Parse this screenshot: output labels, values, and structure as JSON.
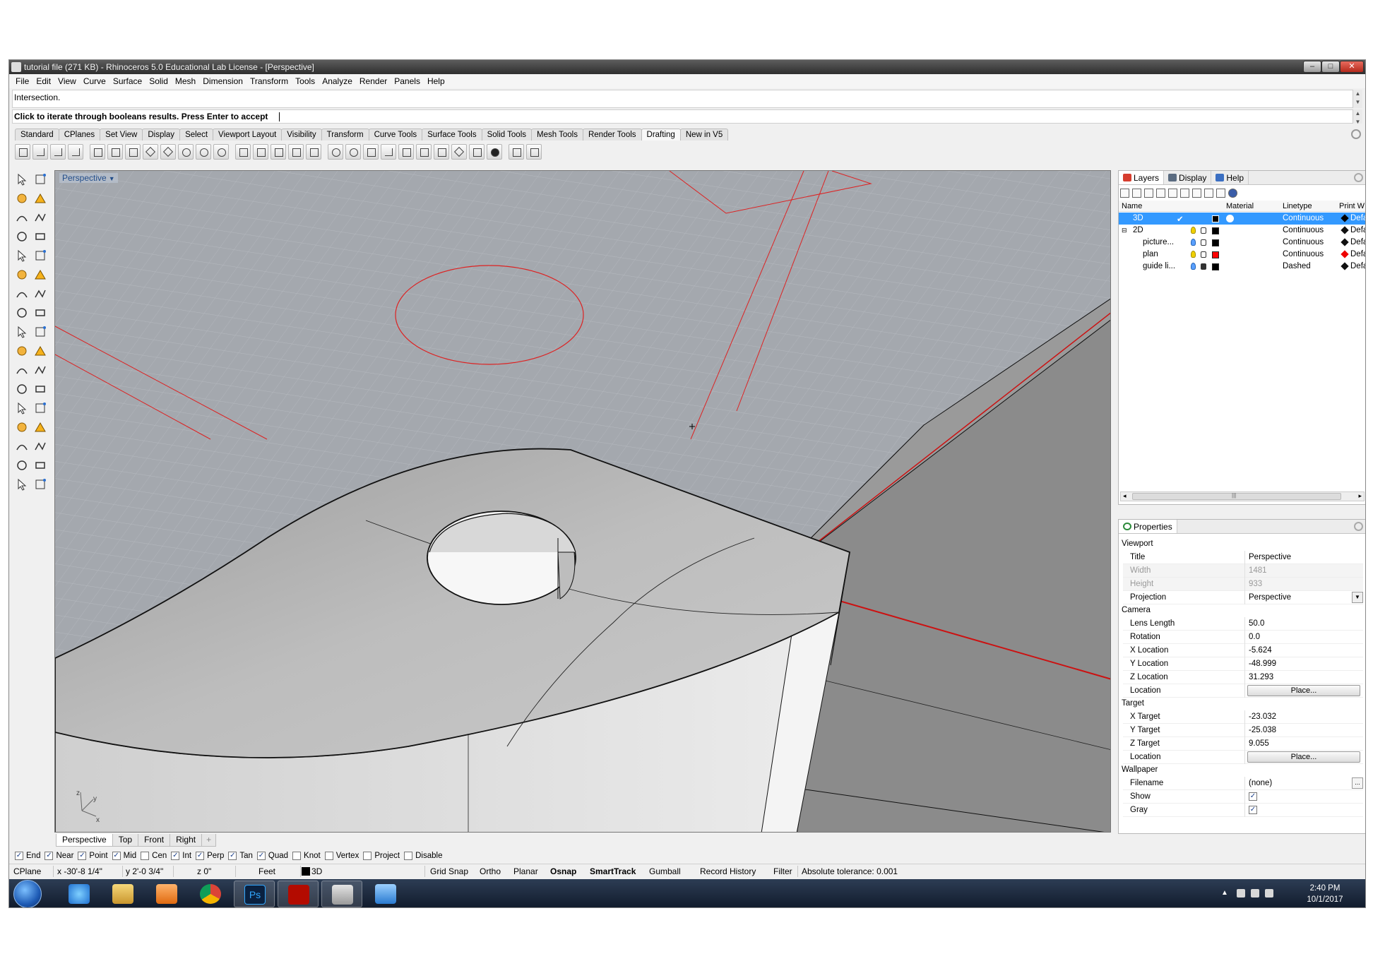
{
  "window": {
    "title": "tutorial file (271 KB) - Rhinoceros 5.0 Educational Lab License - [Perspective]",
    "minimize": "–",
    "maximize": "□",
    "close": "✕"
  },
  "menu": [
    "File",
    "Edit",
    "View",
    "Curve",
    "Surface",
    "Solid",
    "Mesh",
    "Dimension",
    "Transform",
    "Tools",
    "Analyze",
    "Render",
    "Panels",
    "Help"
  ],
  "command": {
    "history": "Intersection.",
    "prompt": "Click to iterate through booleans results. Press Enter to accept"
  },
  "toolbar_tabs": [
    "Standard",
    "CPlanes",
    "Set View",
    "Display",
    "Select",
    "Viewport Layout",
    "Visibility",
    "Transform",
    "Curve Tools",
    "Surface Tools",
    "Solid Tools",
    "Mesh Tools",
    "Render Tools",
    "Drafting",
    "New in V5"
  ],
  "active_toolbar_tab": "Drafting",
  "viewport": {
    "label": "Perspective",
    "axes": {
      "z": "z",
      "y": "y",
      "x": "x"
    }
  },
  "viewport_tabs": [
    "Perspective",
    "Top",
    "Front",
    "Right",
    "+"
  ],
  "layers_panel": {
    "tabs": [
      "Layers",
      "Display",
      "Help"
    ],
    "columns": {
      "name": "Name",
      "material": "Material",
      "linetype": "Linetype",
      "print": "Print W"
    },
    "rows": [
      {
        "name": "3D",
        "current": "✔",
        "linetype": "Continuous",
        "print": "Defau",
        "color": "#000000",
        "selected": true
      },
      {
        "name": "2D",
        "expander": "⊟",
        "linetype": "Continuous",
        "print": "Default",
        "color": "#000000"
      },
      {
        "name": "picture...",
        "linetype": "Continuous",
        "print": "Default",
        "color": "#000000"
      },
      {
        "name": "plan",
        "linetype": "Continuous",
        "print": "Default",
        "color": "#ff0000"
      },
      {
        "name": "guide li...",
        "linetype": "Dashed",
        "print": "Default",
        "color": "#000000"
      }
    ],
    "scroll_marker": "|||"
  },
  "properties_panel": {
    "tab": "Properties",
    "sections": {
      "viewport": "Viewport",
      "camera": "Camera",
      "target": "Target",
      "wallpaper": "Wallpaper"
    },
    "viewport": {
      "title_label": "Title",
      "title": "Perspective",
      "width_label": "Width",
      "width": "1481",
      "height_label": "Height",
      "height": "933",
      "projection_label": "Projection",
      "projection": "Perspective"
    },
    "camera": {
      "lens_label": "Lens Length",
      "lens": "50.0",
      "rotation_label": "Rotation",
      "rotation": "0.0",
      "x_label": "X Location",
      "x": "-5.624",
      "y_label": "Y Location",
      "y": "-48.999",
      "z_label": "Z Location",
      "z": "31.293",
      "location_label": "Location",
      "place": "Place..."
    },
    "target": {
      "x_label": "X Target",
      "x": "-23.032",
      "y_label": "Y Target",
      "y": "-25.038",
      "z_label": "Z Target",
      "z": "9.055",
      "location_label": "Location",
      "place": "Place..."
    },
    "wallpaper": {
      "filename_label": "Filename",
      "filename": "(none)",
      "browse": "...",
      "show_label": "Show",
      "show": "✓",
      "gray_label": "Gray",
      "gray": "✓"
    }
  },
  "osnaps": [
    {
      "label": "End",
      "checked": true
    },
    {
      "label": "Near",
      "checked": true
    },
    {
      "label": "Point",
      "checked": true
    },
    {
      "label": "Mid",
      "checked": true
    },
    {
      "label": "Cen",
      "checked": false
    },
    {
      "label": "Int",
      "checked": true
    },
    {
      "label": "Perp",
      "checked": true
    },
    {
      "label": "Tan",
      "checked": true
    },
    {
      "label": "Quad",
      "checked": true
    },
    {
      "label": "Knot",
      "checked": false
    },
    {
      "label": "Vertex",
      "checked": false
    },
    {
      "label": "Project",
      "checked": false
    },
    {
      "label": "Disable",
      "checked": false
    }
  ],
  "status": {
    "cplane": "CPlane",
    "x": "x -30'-8 1/4\"",
    "y": "y 2'-0 3/4\"",
    "z": "z 0\"",
    "units": "Feet",
    "layer": "3D",
    "grid_snap": "Grid Snap",
    "ortho": "Ortho",
    "planar": "Planar",
    "osnap": "Osnap",
    "smarttrack": "SmartTrack",
    "gumball": "Gumball",
    "record_history": "Record History",
    "filter": "Filter",
    "tolerance": "Absolute tolerance: 0.001"
  },
  "taskbar": {
    "apps": [
      "internet-explorer",
      "file-explorer",
      "media-player",
      "chrome",
      "photoshop",
      "acrobat",
      "rhinoceros",
      "picture-viewer"
    ],
    "time": "2:40 PM",
    "date": "10/1/2017"
  }
}
